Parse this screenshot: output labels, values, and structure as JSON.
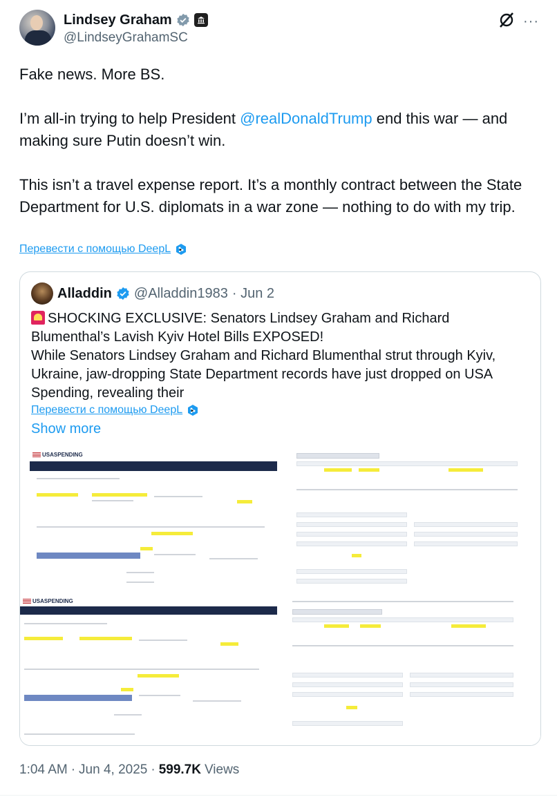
{
  "author": {
    "name": "Lindsey Graham",
    "handle": "@LindseyGrahamSC",
    "verified_icon": "verified-badge-icon",
    "affiliation_icon": "government-building-icon"
  },
  "actions": {
    "grok_icon": "grok-icon",
    "more_icon": "more-options-icon",
    "more_label": "···"
  },
  "tweet": {
    "line1": "Fake news. More BS.",
    "p2_before": "I’m all-in trying to help President ",
    "p2_mention": "@realDonaldTrump",
    "p2_after": " end this war — and making sure Putin doesn’t win.",
    "p3": "This isn’t a travel expense report. It’s a monthly contract between the State Department for U.S. diplomats in a war zone — nothing to do with my trip."
  },
  "translate_label": "Перевести с помощью DeepL",
  "quoted": {
    "name": "Alladdin",
    "handle": "@Alladdin1983",
    "date": "· Jun 2",
    "text_p1": "SHOCKING EXCLUSIVE: Senators Lindsey Graham and Richard Blumenthal’s Lavish Kyiv Hotel Bills EXPOSED!",
    "text_p2": "While Senators Lindsey Graham and Richard Blumenthal strut through Kyiv, Ukraine, jaw-dropping State Department records have just dropped on USA Spending, revealing their",
    "translate_label": "Перевести с помощью DeepL",
    "show_more": "Show more"
  },
  "media": {
    "logo_top": "USASPENDING",
    "logo_bottom": "USASPENDING"
  },
  "footer": {
    "time": "1:04 AM",
    "sep1": "·",
    "date": "Jun 4, 2025",
    "sep2": "·",
    "views_count": "599.7K",
    "views_label": "Views"
  },
  "colors": {
    "link": "#1d9bf0",
    "verified": "#1d9bf0",
    "secondary_text": "#536471",
    "highlight": "#f5ec3a",
    "usaspending_navy": "#1c2a4a"
  }
}
